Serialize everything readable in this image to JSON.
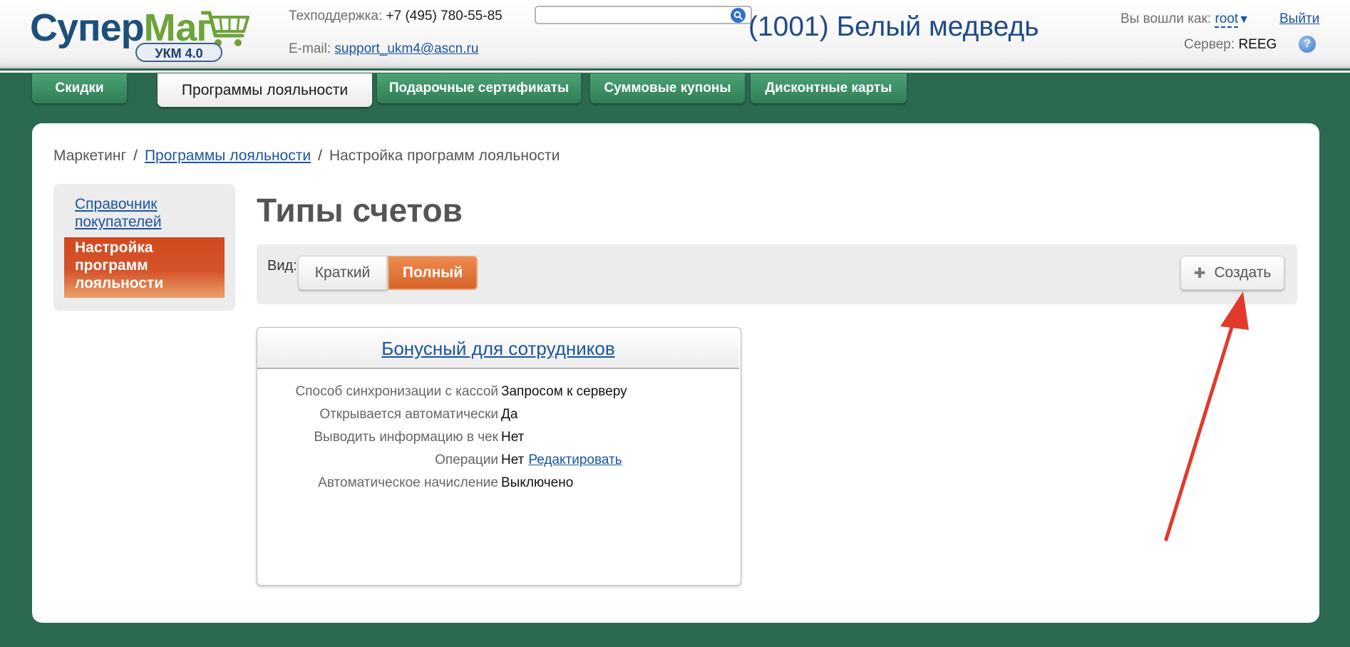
{
  "header": {
    "logo": {
      "part1": "Супер",
      "part2": "Маг",
      "badge": "УКМ 4.0"
    },
    "support_label": "Техподдержка:",
    "support_phone": "+7 (495) 780-55-85",
    "email_label": "E-mail:",
    "email": "support_ukm4@ascn.ru",
    "search_value": "",
    "store_title": "(1001) Белый медведь",
    "logged_label": "Вы вошли как:",
    "user": "root",
    "logout": "Выйти",
    "server_label": "Сервер:",
    "server": "REEG",
    "help": "?"
  },
  "tabs": [
    {
      "label": "Скидки",
      "active": false
    },
    {
      "label": "Программы лояльности",
      "active": true
    },
    {
      "label": "Подарочные сертификаты",
      "active": false
    },
    {
      "label": "Суммовые купоны",
      "active": false
    },
    {
      "label": "Дисконтные карты",
      "active": false
    }
  ],
  "breadcrumb": {
    "root": "Маркетинг",
    "link": "Программы лояльности",
    "current": "Настройка программ лояльности",
    "separator": "/"
  },
  "sidebar": {
    "items": [
      {
        "label": "Справочник покупателей",
        "active": false
      },
      {
        "label": "Настройка программ лояльности",
        "active": true
      }
    ]
  },
  "main": {
    "title": "Типы счетов",
    "view_label": "Вид:",
    "view_options": [
      "Краткий",
      "Полный"
    ],
    "view_selected": "Полный",
    "create_label": "Создать"
  },
  "card": {
    "title": "Бонусный для сотрудников",
    "props": [
      {
        "label": "Способ синхронизации с кассой",
        "value": "Запросом к серверу"
      },
      {
        "label": "Открывается автоматически",
        "value": "Да"
      },
      {
        "label": "Выводить информацию в чек",
        "value": "Нет"
      },
      {
        "label": "Операции",
        "value": "Нет",
        "link": "Редактировать"
      },
      {
        "label": "Автоматическое начисление",
        "value": "Выключено"
      }
    ]
  },
  "colors": {
    "accent": "#d6642a",
    "brand_green": "#2b6a50",
    "link": "#1a55a3",
    "annotation_arrow": "#e23a2a"
  },
  "icons": {
    "search": "search-icon",
    "cart": "cart-icon",
    "help": "help-icon",
    "create": "plus-icon",
    "user_menu": "chevron-down-icon"
  }
}
